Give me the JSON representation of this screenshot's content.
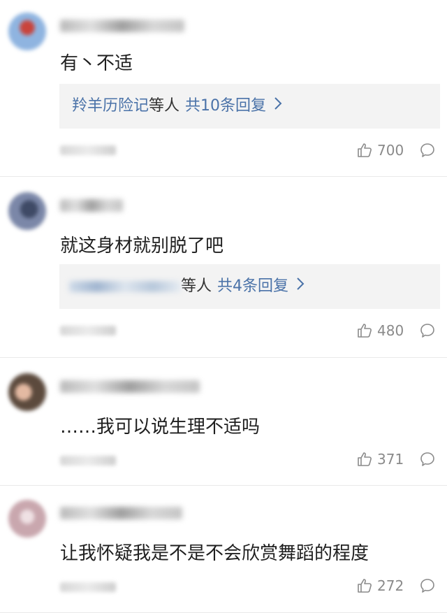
{
  "comments": [
    {
      "text": "有丶不适",
      "reply_names": "羚羊历险记",
      "reply_etc": "等人",
      "reply_count": "共10条回复",
      "likes": "700",
      "avatar_color": "#8fb4e0"
    },
    {
      "text": "就这身材就别脱了吧",
      "reply_etc": "等人",
      "reply_count": "共4条回复",
      "likes": "480",
      "avatar_color": "#6d7a99"
    },
    {
      "text": "……我可以说生理不适吗",
      "likes": "371",
      "avatar_color": "#b68a73"
    },
    {
      "text": "让我怀疑我是不是不会欣赏舞蹈的程度",
      "likes": "272",
      "avatar_color": "#d6b9bf"
    }
  ],
  "icons": {
    "like": "thumbs-up-icon",
    "reply": "speech-bubble-icon",
    "chevron": "chevron-right-icon"
  },
  "colors": {
    "link": "#4a72a8",
    "muted": "#8a8a8a",
    "reply_bg": "#f3f3f3"
  }
}
